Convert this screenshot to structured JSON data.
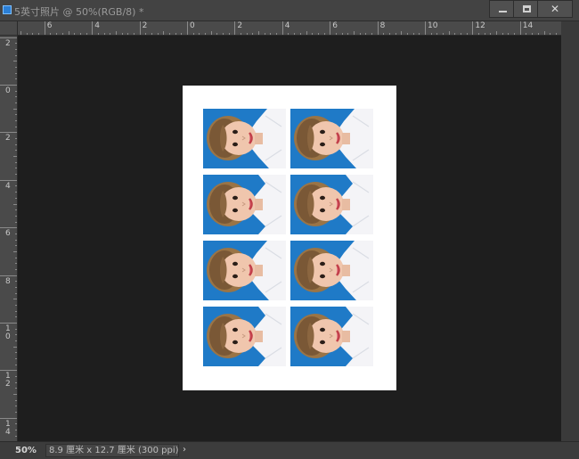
{
  "window": {
    "title": "5英寸照片 @ 50%(RGB/8) *",
    "minimize_glyph": "",
    "close_glyph": "✕"
  },
  "rulers": {
    "top_labels": [
      "6",
      "4",
      "2",
      "0",
      "2",
      "4",
      "6",
      "8",
      "10",
      "12",
      "14"
    ],
    "left_labels": [
      "2",
      "0",
      "2",
      "4",
      "6",
      "8",
      "1\n0",
      "1\n2",
      "1\n4"
    ]
  },
  "document": {
    "photo_layout": {
      "rows": 4,
      "columns": 2
    },
    "photo_background_color": "#1f7ac7",
    "sheet_color": "#ffffff"
  },
  "statusbar": {
    "zoom": "50%",
    "doc_size": "8.9 厘米 x 12.7 厘米 (300 ppi)",
    "arrow": "›"
  }
}
